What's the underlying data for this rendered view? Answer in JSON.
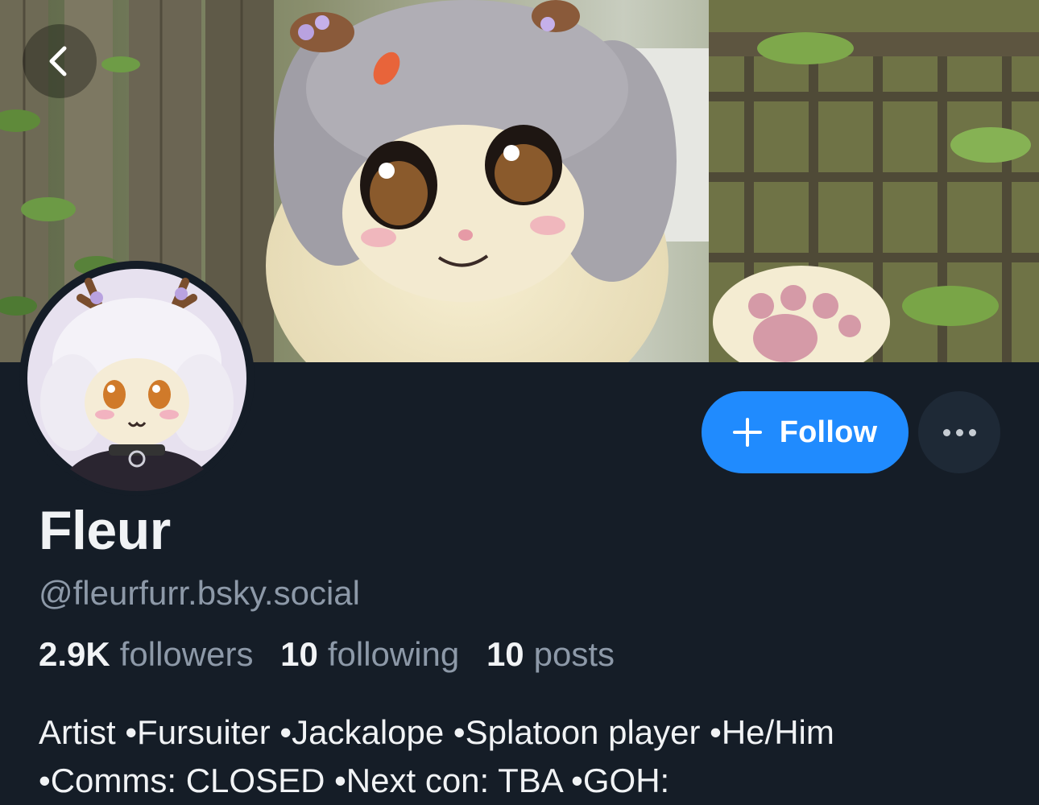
{
  "profile": {
    "display_name": "Fleur",
    "handle": "@fleurfurr.bsky.social",
    "stats": {
      "followers_count": "2.9K",
      "followers_label": "followers",
      "following_count": "10",
      "following_label": "following",
      "posts_count": "10",
      "posts_label": "posts"
    },
    "bio_lines": [
      "Artist •Fursuiter •Jackalope •Splatoon player •He/Him",
      "•Comms: CLOSED •Next con: TBA •GOH:"
    ]
  },
  "actions": {
    "follow_label": "Follow",
    "follow_icon": "plus-icon",
    "more_icon": "ellipsis-icon",
    "back_icon": "chevron-left-icon"
  },
  "colors": {
    "background": "#151d27",
    "accent": "#208bfe",
    "muted_text": "#8d99a8",
    "primary_text": "#f1f3f5",
    "secondary_button": "#1e2936"
  }
}
